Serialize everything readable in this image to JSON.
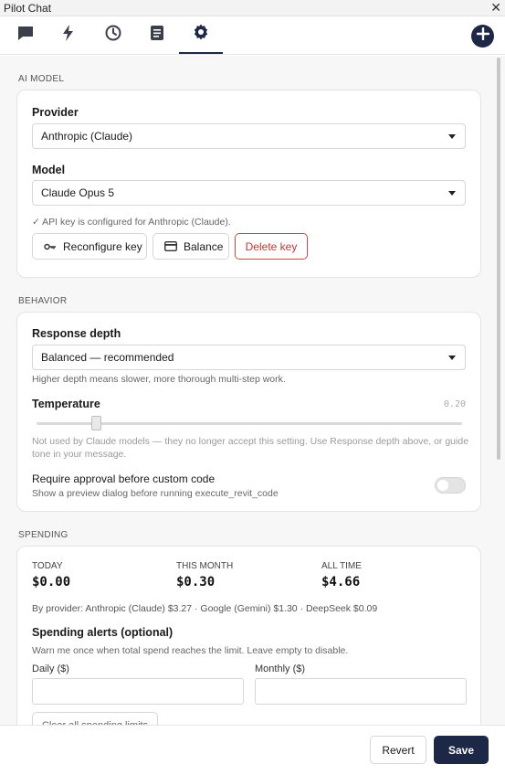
{
  "window": {
    "title": "Pilot Chat",
    "close_glyph": "✕"
  },
  "tabs": [
    {
      "icon": "chat-icon"
    },
    {
      "icon": "lightning-icon"
    },
    {
      "icon": "clock-icon"
    },
    {
      "icon": "document-icon"
    },
    {
      "icon": "gear-icon",
      "active": true
    }
  ],
  "new_chat": {
    "icon": "plus-icon"
  },
  "ai_model": {
    "section_label": "AI MODEL",
    "provider_label": "Provider",
    "provider_value": "Anthropic (Claude)",
    "model_label": "Model",
    "model_value": "Claude Opus 5",
    "api_status": "✓ API key is configured for Anthropic (Claude).",
    "reconfigure_label": "Reconfigure key",
    "balance_label": "Balance",
    "delete_label": "Delete key"
  },
  "behavior": {
    "section_label": "BEHAVIOR",
    "depth_label": "Response depth",
    "depth_value": "Balanced — recommended",
    "depth_hint": "Higher depth means slower, more thorough multi-step work.",
    "temperature_label": "Temperature",
    "temperature_value": "0.20",
    "temperature_fraction": 0.14,
    "temperature_note": "Not used by Claude models — they no longer accept this setting. Use Response depth above, or guide tone in your message.",
    "approval_label": "Require approval before custom code",
    "approval_hint": "Show a preview dialog before running execute_revit_code",
    "approval_enabled": false
  },
  "spending": {
    "section_label": "SPENDING",
    "today_label": "TODAY",
    "today_value": "$0.00",
    "month_label": "THIS MONTH",
    "month_value": "$0.30",
    "alltime_label": "ALL TIME",
    "alltime_value": "$4.66",
    "by_provider": "By provider: Anthropic (Claude) $3.27 · Google (Gemini) $1.30 · DeepSeek $0.09",
    "alerts_label": "Spending alerts (optional)",
    "alerts_hint": "Warn me once when total spend reaches the limit. Leave empty to disable.",
    "daily_label": "Daily ($)",
    "daily_value": "",
    "monthly_label": "Monthly ($)",
    "monthly_value": "",
    "clear_label": "Clear all spending limits"
  },
  "footer": {
    "revert_label": "Revert",
    "save_label": "Save"
  },
  "colors": {
    "accent": "#1d2746",
    "danger": "#d64545"
  }
}
